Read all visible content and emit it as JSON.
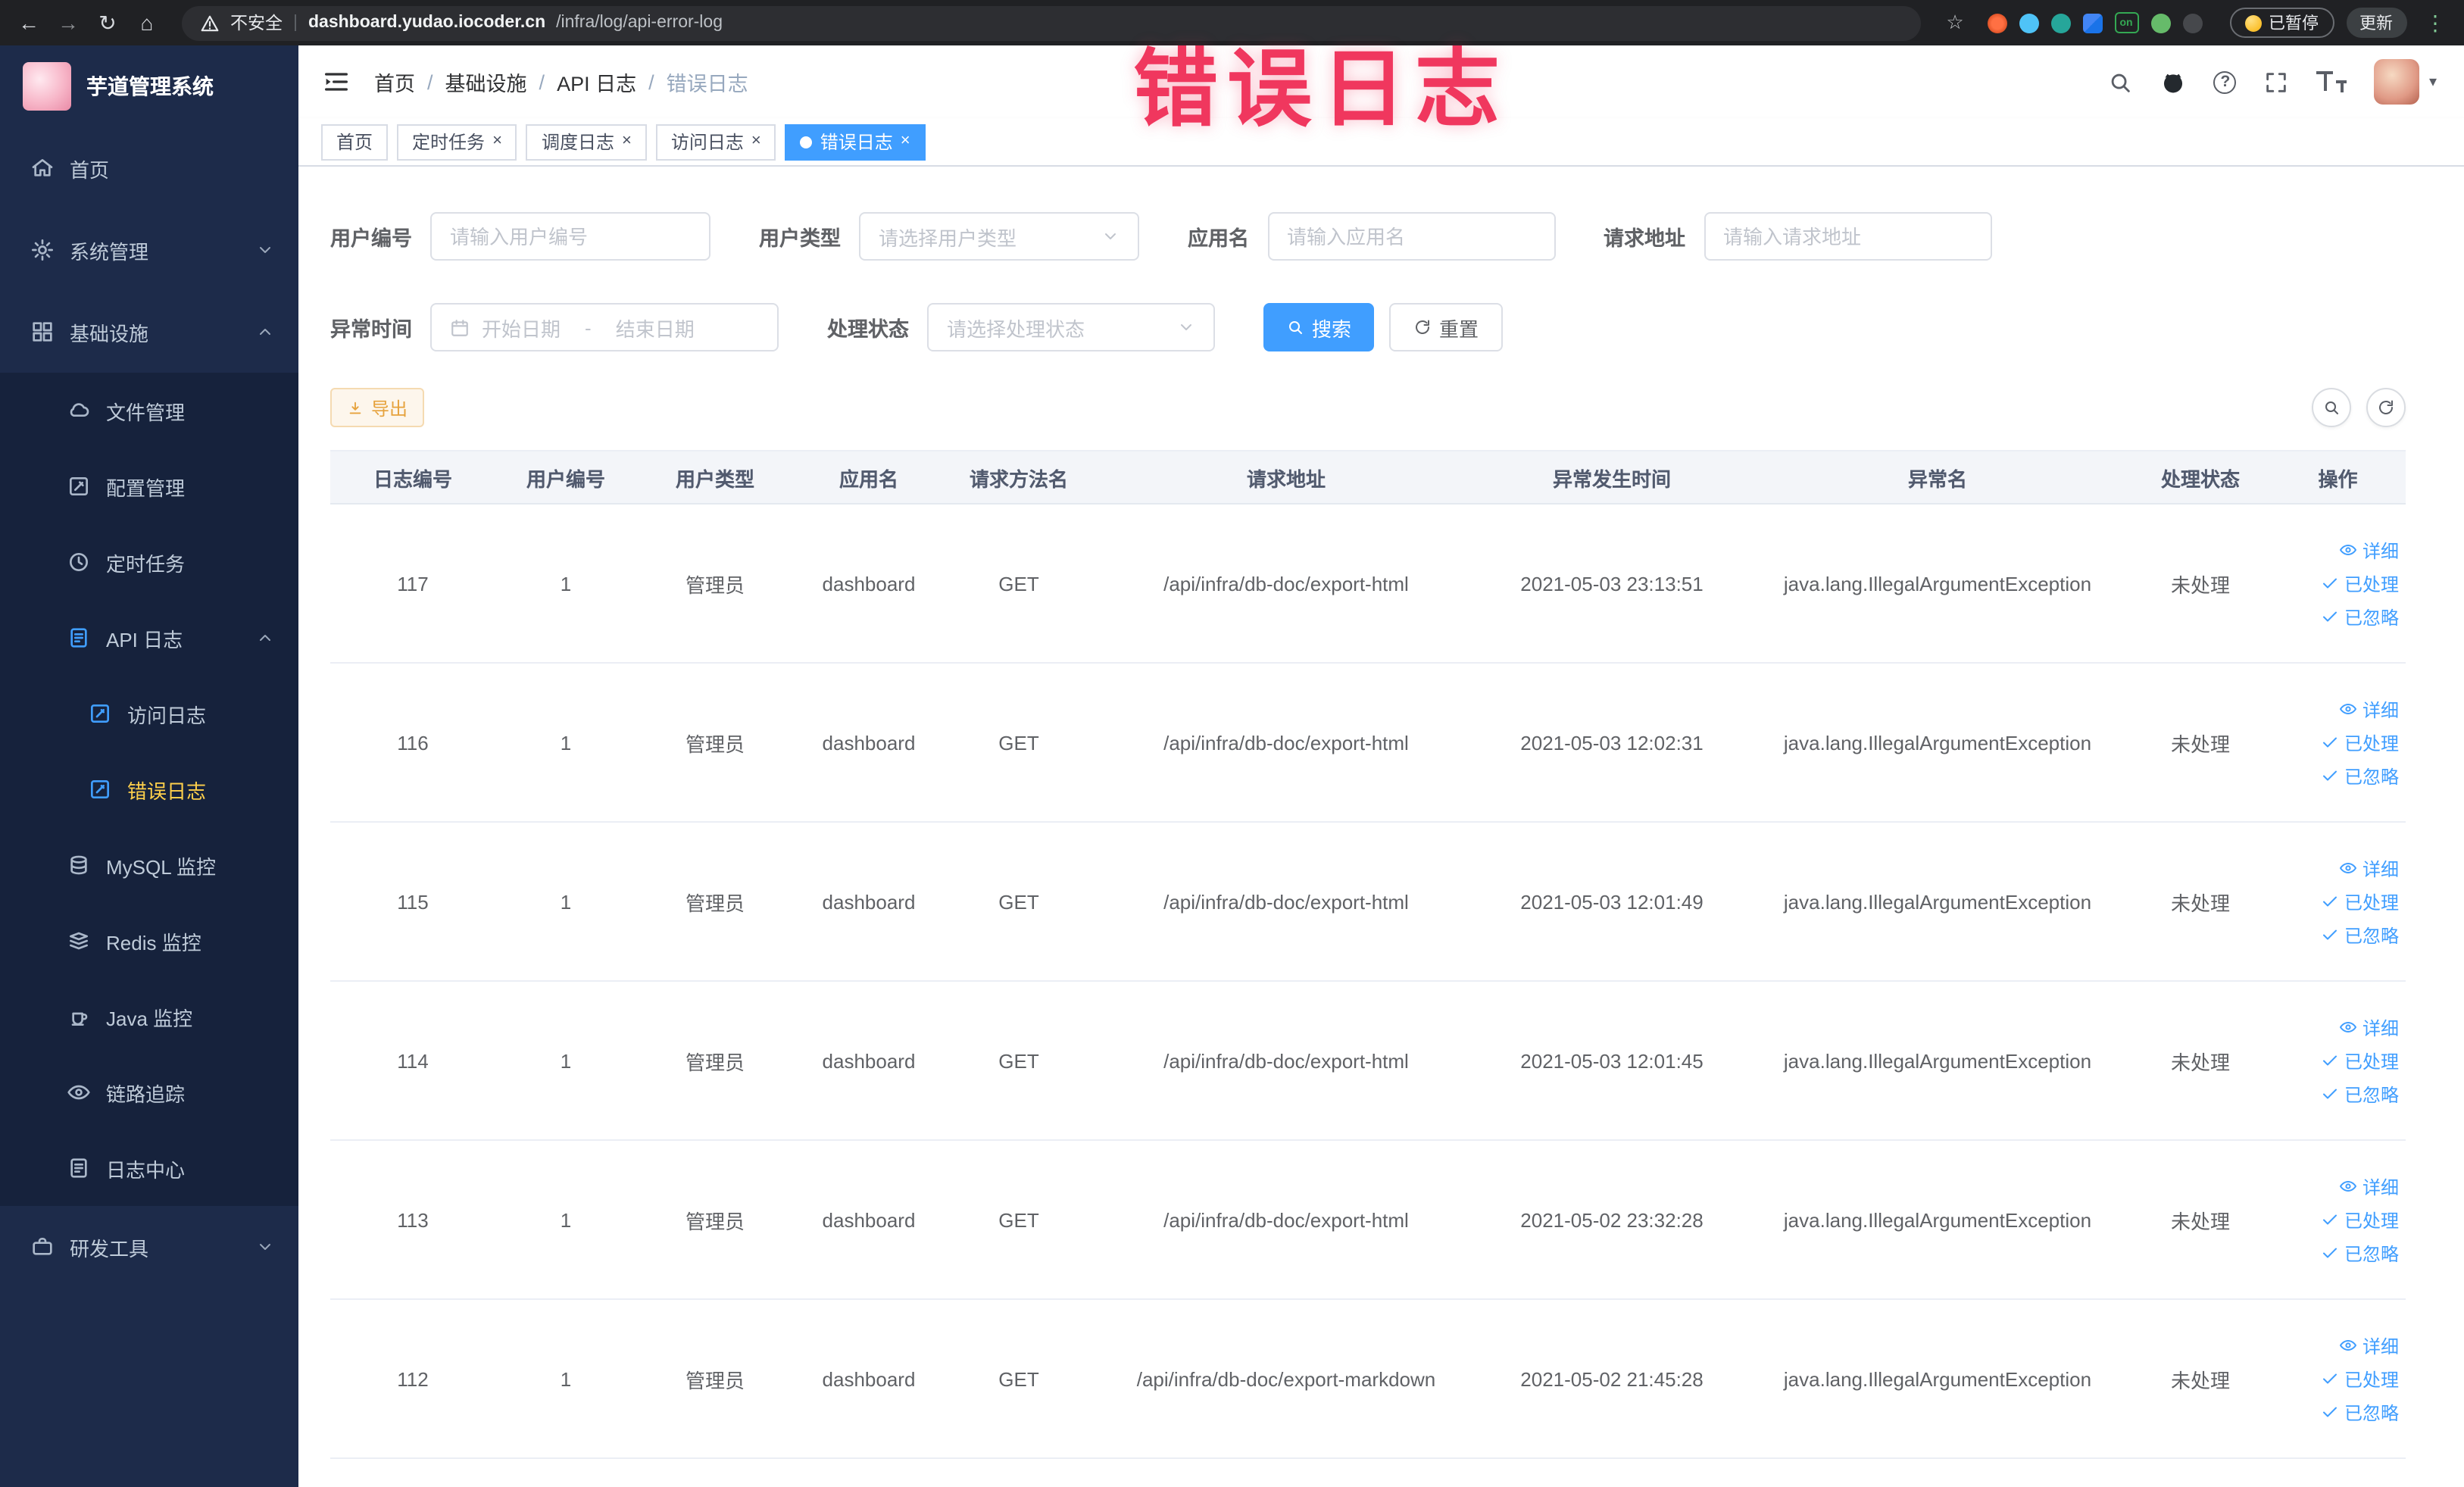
{
  "colors": {
    "accent": "#409eff",
    "warning": "#e6a23c",
    "annotation_pink": "#f0375e",
    "sidebar_bg": "#1d2b4a",
    "chrome_bg": "#202124",
    "active_menu_text": "#ffd04b"
  },
  "glyphs": {
    "back": "←",
    "forward": "→",
    "reload": "↻",
    "home": "⌂",
    "star": "☆",
    "divider": "|",
    "menu_dots": "⋮",
    "close": "×",
    "caret": "▾",
    "question": "?",
    "separator": "/"
  },
  "browser": {
    "security_label": "不安全",
    "url_domain": "dashboard.yudao.iocoder.cn",
    "url_path": "/infra/log/api-error-log",
    "extension_badge": "on",
    "paused_button": "已暂停",
    "update_button": "更新"
  },
  "sidebar": {
    "logo_title": "芋道管理系统",
    "home": "首页",
    "system_mgmt": "系统管理",
    "infrastructure": "基础设施",
    "file_mgmt": "文件管理",
    "config_mgmt": "配置管理",
    "scheduled_jobs": "定时任务",
    "api_log": "API 日志",
    "access_log": "访问日志",
    "error_log": "错误日志",
    "mysql_monitor": "MySQL 监控",
    "redis_monitor": "Redis 监控",
    "java_monitor": "Java 监控",
    "tracing": "链路追踪",
    "log_center": "日志中心",
    "dev_tools": "研发工具"
  },
  "header": {
    "breadcrumb": [
      "首页",
      "基础设施",
      "API 日志",
      "错误日志"
    ]
  },
  "annotation": "错误日志",
  "tabs": [
    {
      "label": "首页",
      "closable": false,
      "active": false
    },
    {
      "label": "定时任务",
      "closable": true,
      "active": false
    },
    {
      "label": "调度日志",
      "closable": true,
      "active": false
    },
    {
      "label": "访问日志",
      "closable": true,
      "active": false
    },
    {
      "label": "错误日志",
      "closable": true,
      "active": true
    }
  ],
  "filters": {
    "user_id": {
      "label": "用户编号",
      "placeholder": "请输入用户编号"
    },
    "user_type": {
      "label": "用户类型",
      "placeholder": "请选择用户类型"
    },
    "app_name": {
      "label": "应用名",
      "placeholder": "请输入应用名"
    },
    "request_url": {
      "label": "请求地址",
      "placeholder": "请输入请求地址"
    },
    "exception_time": {
      "label": "异常时间",
      "start_placeholder": "开始日期",
      "separator": "-",
      "end_placeholder": "结束日期"
    },
    "process_status": {
      "label": "处理状态",
      "placeholder": "请选择处理状态"
    },
    "search_button": "搜索",
    "reset_button": "重置"
  },
  "toolbar": {
    "export": "导出"
  },
  "table": {
    "columns": [
      "日志编号",
      "用户编号",
      "用户类型",
      "应用名",
      "请求方法名",
      "请求地址",
      "异常发生时间",
      "异常名",
      "处理状态",
      "操作"
    ],
    "actions": [
      "详细",
      "已处理",
      "已忽略"
    ],
    "rows": [
      {
        "id": "117",
        "user_id": "1",
        "user_type": "管理员",
        "app": "dashboard",
        "method": "GET",
        "url": "/api/infra/db-doc/export-html",
        "time": "2021-05-03 23:13:51",
        "exception": "java.lang.IllegalArgumentException",
        "status": "未处理"
      },
      {
        "id": "116",
        "user_id": "1",
        "user_type": "管理员",
        "app": "dashboard",
        "method": "GET",
        "url": "/api/infra/db-doc/export-html",
        "time": "2021-05-03 12:02:31",
        "exception": "java.lang.IllegalArgumentException",
        "status": "未处理"
      },
      {
        "id": "115",
        "user_id": "1",
        "user_type": "管理员",
        "app": "dashboard",
        "method": "GET",
        "url": "/api/infra/db-doc/export-html",
        "time": "2021-05-03 12:01:49",
        "exception": "java.lang.IllegalArgumentException",
        "status": "未处理"
      },
      {
        "id": "114",
        "user_id": "1",
        "user_type": "管理员",
        "app": "dashboard",
        "method": "GET",
        "url": "/api/infra/db-doc/export-html",
        "time": "2021-05-03 12:01:45",
        "exception": "java.lang.IllegalArgumentException",
        "status": "未处理"
      },
      {
        "id": "113",
        "user_id": "1",
        "user_type": "管理员",
        "app": "dashboard",
        "method": "GET",
        "url": "/api/infra/db-doc/export-html",
        "time": "2021-05-02 23:32:28",
        "exception": "java.lang.IllegalArgumentException",
        "status": "未处理"
      },
      {
        "id": "112",
        "user_id": "1",
        "user_type": "管理员",
        "app": "dashboard",
        "method": "GET",
        "url": "/api/infra/db-doc/export-markdown",
        "time": "2021-05-02 21:45:28",
        "exception": "java.lang.IllegalArgumentException",
        "status": "未处理"
      }
    ]
  }
}
